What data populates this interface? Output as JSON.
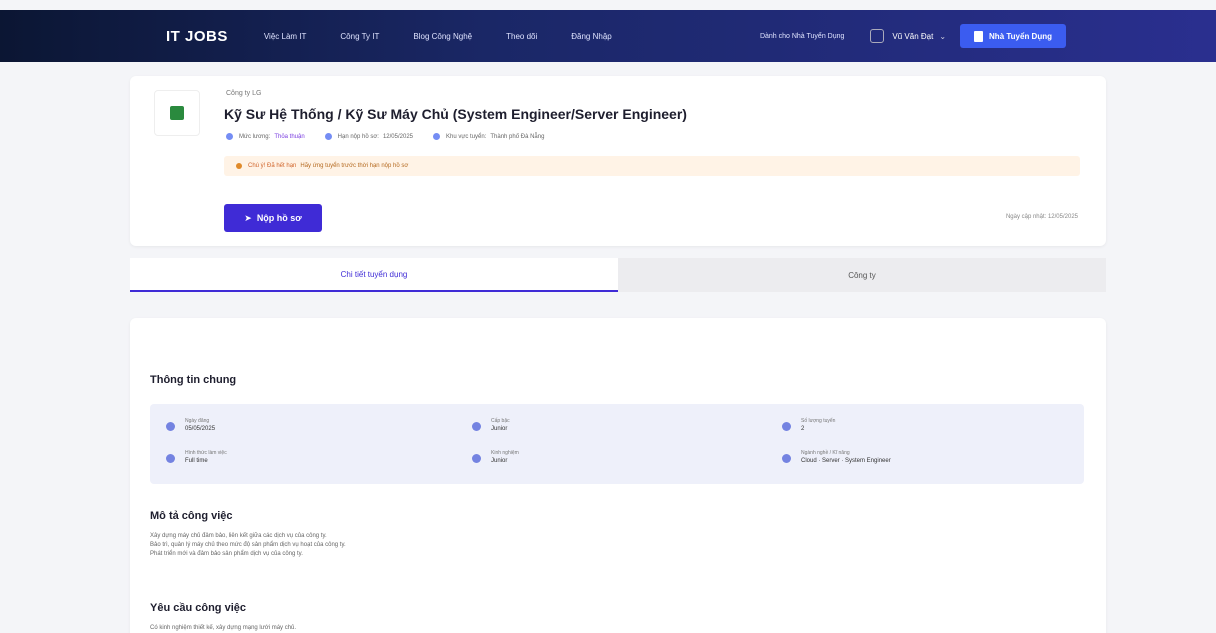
{
  "nav": {
    "logo": "IT JOBS",
    "links": [
      "Việc Làm IT",
      "Công Ty IT",
      "Blog Công Nghệ",
      "Theo dõi",
      "Đăng Nhập"
    ],
    "employer_link": "Dành cho Nhà Tuyển Dụng",
    "user_name": "Vũ Văn Đạt",
    "post_button": "Nhà Tuyển Dụng"
  },
  "job": {
    "company": "Công ty LG",
    "title": "Kỹ Sư Hệ Thống / Kỹ Sư Máy Chủ (System Engineer/Server Engineer)",
    "salary_label": "Mức lương:",
    "salary_value": "Thỏa thuận",
    "deadline_label": "Hạn nộp hồ sơ:",
    "deadline_value": "12/05/2025",
    "location_label": "Khu vực tuyển:",
    "location_value": "Thành phố Đà Nẵng",
    "warning_strong": "Chú ý! Đã hết hạn",
    "warning_text": "Hãy ứng tuyển trước thời hạn nộp hồ sơ",
    "apply_button": "Nộp hồ sơ",
    "deadline_note": "Ngày cập nhật: 12/05/2025"
  },
  "tabs": [
    "Chi tiết tuyển dụng",
    "Công ty"
  ],
  "details": {
    "general_title": "Thông tin chung",
    "info": [
      {
        "label": "Ngày đăng",
        "value": "05/05/2025"
      },
      {
        "label": "Cấp bậc",
        "value": "Junior"
      },
      {
        "label": "Số lượng tuyển",
        "value": "2"
      },
      {
        "label": "Hình thức làm việc",
        "value": "Full time"
      },
      {
        "label": "Kinh nghiệm",
        "value": "Junior"
      },
      {
        "label": "Ngành nghề / Kĩ năng",
        "value": "Cloud · Server · System Engineer"
      }
    ],
    "desc_title": "Mô tả công việc",
    "desc_lines": [
      "Xây dựng máy chủ đảm bảo, liên kết giữa các dịch vụ của công ty.",
      "Bảo trì, quản lý máy chủ theo mức độ sản phẩm dịch vụ hoạt của công ty.",
      "Phát triển mới và đảm bảo sản phẩm dịch vụ của công ty."
    ],
    "req_title": "Yêu cầu công việc",
    "req_line": "Có kinh nghiệm thiết kế, xây dựng mạng lưới máy chủ."
  }
}
